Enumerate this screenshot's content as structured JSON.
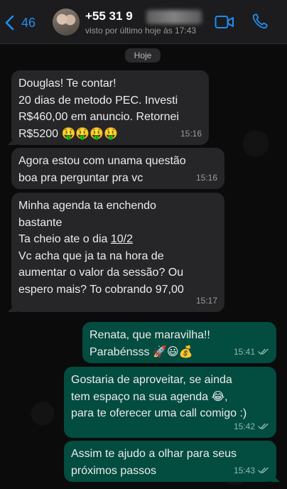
{
  "header": {
    "back_count": "46",
    "contact_name": "+55 31 9",
    "last_seen": "visto por último hoje às 17:43",
    "icons": {
      "back": "chevron-left-icon",
      "video": "video-icon",
      "call": "phone-icon"
    },
    "accent_color": "#1f8ef1"
  },
  "date_divider": "Hoje",
  "messages": [
    {
      "direction": "in",
      "text": "Douglas! Te contar!\n20 dias de metodo PEC. Investi\nR$460,00 em anuncio. Retornei\nR$5200 🤑🤑🤑🤑",
      "time": "15:16"
    },
    {
      "direction": "in",
      "text": "Agora estou com unama questão\nboa pra perguntar pra vc",
      "time": "15:16"
    },
    {
      "direction": "in",
      "text_before": "Minha agenda ta enchendo\nbastante\nTa cheio ate o dia ",
      "text_date": "10/2",
      "text_after": "\nVc acha que ja ta na hora de\naumentar o valor da sessão? Ou\nespero mais? To cobrando 97,00",
      "time": "15:17"
    },
    {
      "direction": "out",
      "text": "Renata, que maravilha!!\nParabénsss 🚀😃💰",
      "time": "15:41"
    },
    {
      "direction": "out",
      "text": "Gostaria de aproveitar, se ainda\ntem espaço na sua agenda 😂,\npara te oferecer uma call comigo :)",
      "time": "15:42"
    },
    {
      "direction": "out",
      "text": "Assim te ajudo a olhar para seus\npróximos passos",
      "time": "15:43"
    }
  ],
  "colors": {
    "incoming_bubble": "#262628",
    "outgoing_bubble": "#034c40",
    "background": "#0b0b0b"
  }
}
